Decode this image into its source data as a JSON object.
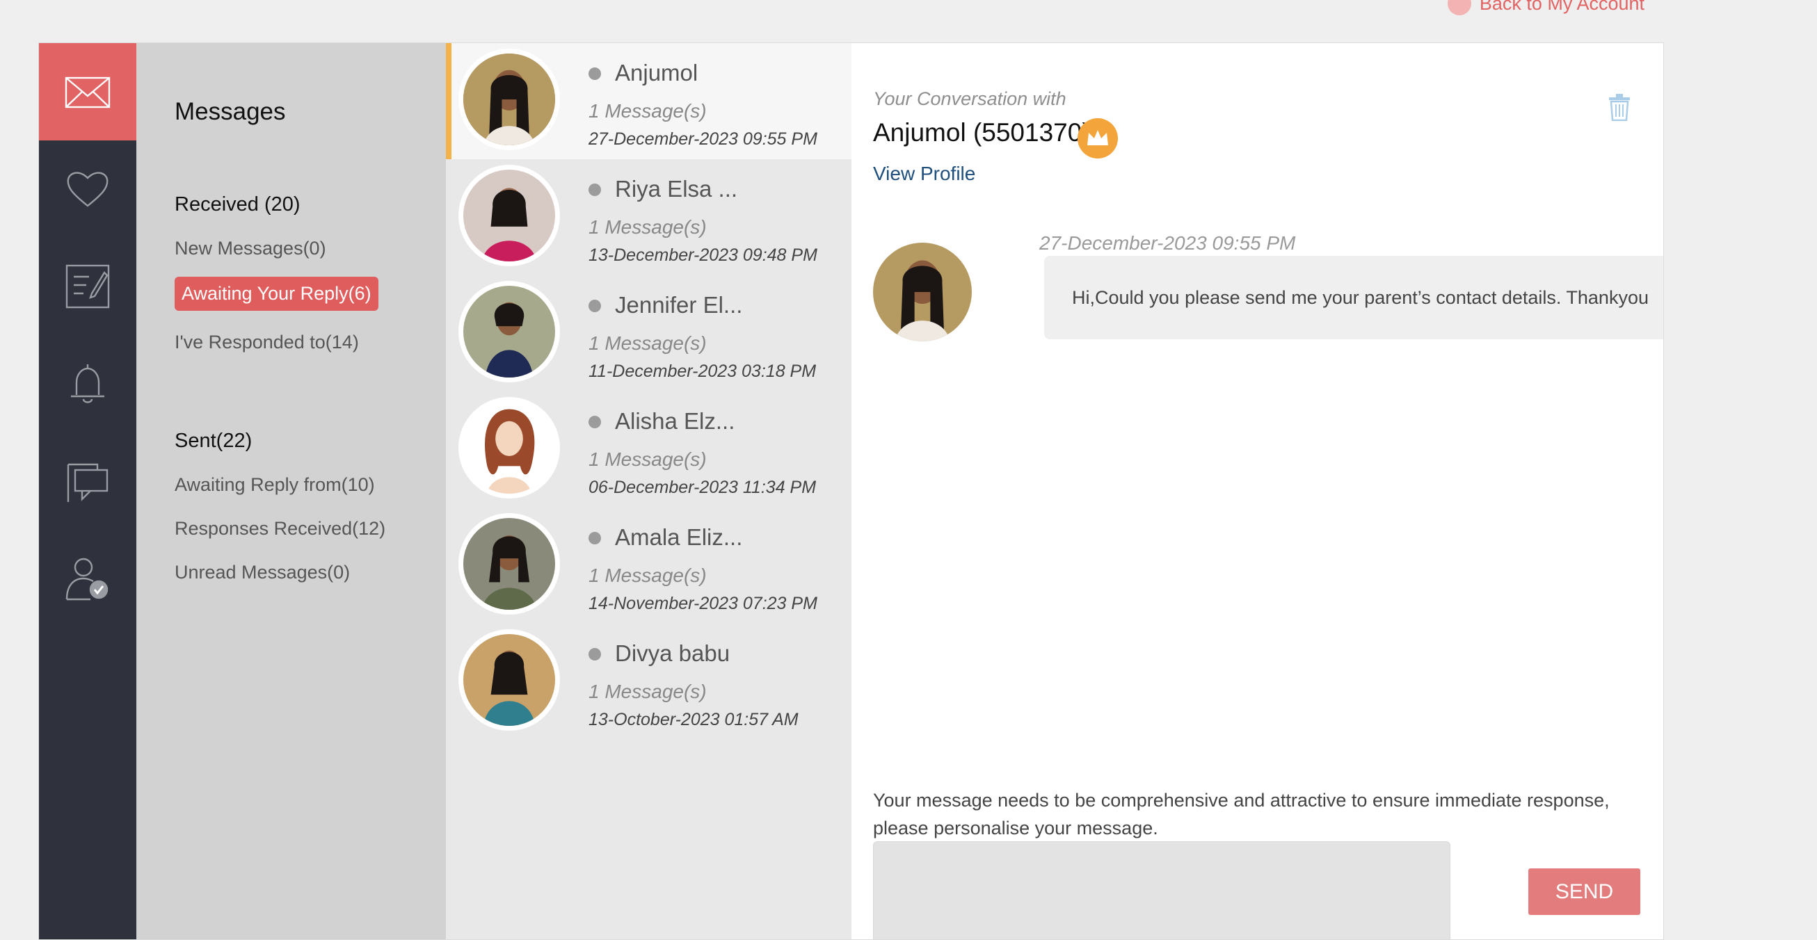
{
  "top": {
    "back_label": "Back to My Account"
  },
  "rail": {
    "items": [
      {
        "icon": "mail-icon",
        "active": true
      },
      {
        "icon": "heart-icon",
        "active": false
      },
      {
        "icon": "edit-note-icon",
        "active": false
      },
      {
        "icon": "bell-icon",
        "active": false
      },
      {
        "icon": "chat-icon",
        "active": false
      },
      {
        "icon": "user-check-icon",
        "active": false
      }
    ]
  },
  "folders": {
    "title": "Messages",
    "received": {
      "heading": "Received (20)",
      "items": [
        "New Messages(0)",
        "Awaiting Your Reply(6)",
        "I've Responded to(14)"
      ],
      "active_index": 1
    },
    "sent": {
      "heading": "Sent(22)",
      "items": [
        "Awaiting Reply from(10)",
        "Responses Received(12)",
        "Unread Messages(0)"
      ]
    }
  },
  "conversations": [
    {
      "name": "Anjumol",
      "count": "1 Message(s)",
      "date": "27-December-2023 09:55 PM",
      "active": true
    },
    {
      "name": "Riya Elsa ...",
      "count": "1 Message(s)",
      "date": "13-December-2023 09:48 PM"
    },
    {
      "name": "Jennifer El...",
      "count": "1 Message(s)",
      "date": "11-December-2023 03:18 PM"
    },
    {
      "name": "Alisha Elz...",
      "count": "1 Message(s)",
      "date": "06-December-2023 11:34 PM"
    },
    {
      "name": "Amala Eliz...",
      "count": "1 Message(s)",
      "date": "14-November-2023 07:23 PM"
    },
    {
      "name": "Divya babu",
      "count": "1 Message(s)",
      "date": "13-October-2023 01:57 AM"
    }
  ],
  "conversation": {
    "with_label": "Your Conversation with",
    "name": "Anjumol (5501370)",
    "view_profile": "View Profile",
    "messages": [
      {
        "date": "27-December-2023 09:55 PM",
        "text": "Hi,Could you please send me your parent’s contact details. Thankyou"
      }
    ],
    "hint": "Your message needs to be comprehensive and attractive to ensure immediate response, please personalise your message.",
    "compose_value": "",
    "send_label": "SEND"
  },
  "colors": {
    "accent": "#e26363",
    "rail_bg": "#2f323d",
    "folder_bg": "#d2d2d2",
    "list_bg": "#e8e8e8",
    "active_marker": "#f3b24a",
    "crown": "#f3a43a",
    "link": "#1f4f7c"
  }
}
